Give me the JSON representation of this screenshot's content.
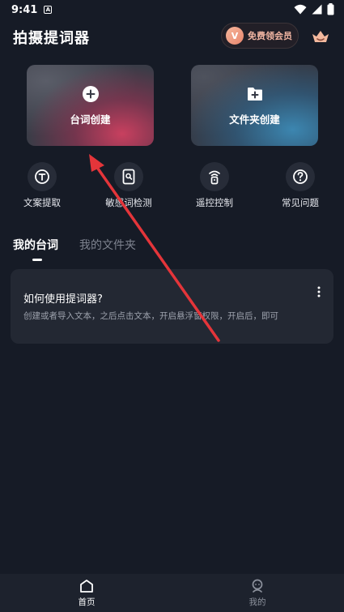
{
  "status_bar": {
    "time": "9:41",
    "badge": "A"
  },
  "header": {
    "title": "拍摄提词器",
    "vip_icon_letter": "V",
    "vip_label": "免费领会员"
  },
  "cards": [
    {
      "label": "台词创建",
      "icon": "plus-circle-icon"
    },
    {
      "label": "文件夹创建",
      "icon": "folder-plus-icon"
    }
  ],
  "tools": [
    {
      "label": "文案提取",
      "icon": "text-extract-icon"
    },
    {
      "label": "敏感词检测",
      "icon": "document-scan-icon"
    },
    {
      "label": "遥控控制",
      "icon": "remote-control-icon"
    },
    {
      "label": "常见问题",
      "icon": "question-icon"
    }
  ],
  "tabs": [
    {
      "label": "我的台词",
      "active": true
    },
    {
      "label": "我的文件夹",
      "active": false
    }
  ],
  "help_card": {
    "title": "如何使用提词器?",
    "description": "创建或者导入文本，之后点击文本，开启悬浮窗权限，开启后，即可"
  },
  "bottom_nav": [
    {
      "label": "首页",
      "active": true
    },
    {
      "label": "我的",
      "active": false
    }
  ],
  "colors": {
    "background": "#161b26",
    "card_bg": "#232833",
    "accent_red": "#e4353a",
    "vip_text": "#f3b7a4"
  }
}
